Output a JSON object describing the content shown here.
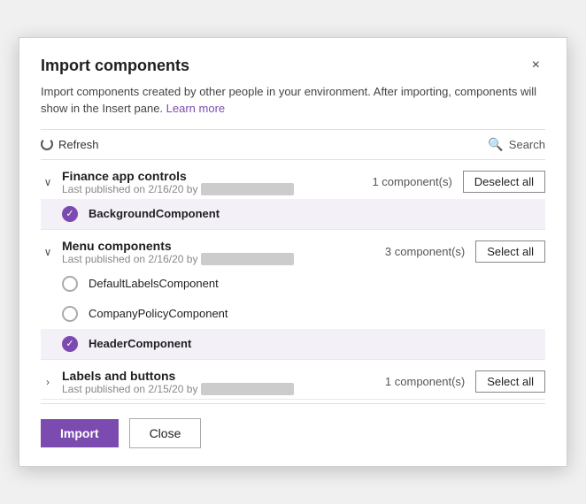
{
  "dialog": {
    "title": "Import components",
    "close_label": "×",
    "description": "Import components created by other people in your environment. After importing, components will show in the Insert pane.",
    "learn_more": "Learn more",
    "toolbar": {
      "refresh_label": "Refresh",
      "search_placeholder": "Search"
    },
    "groups": [
      {
        "id": "finance",
        "name": "Finance app controls",
        "meta": "Last published on 2/16/20 by",
        "author_blur": "████ ████████",
        "count": "1 component(s)",
        "action_label": "Deselect all",
        "action_type": "deselect",
        "expanded": true,
        "components": [
          {
            "id": "bg",
            "name": "BackgroundComponent",
            "selected": true
          }
        ]
      },
      {
        "id": "menu",
        "name": "Menu components",
        "meta": "Last published on 2/16/20 by",
        "author_blur": "████ ████████",
        "count": "3 component(s)",
        "action_label": "Select all",
        "action_type": "select",
        "expanded": true,
        "components": [
          {
            "id": "dlc",
            "name": "DefaultLabelsComponent",
            "selected": false
          },
          {
            "id": "cpc",
            "name": "CompanyPolicyComponent",
            "selected": false
          },
          {
            "id": "hc",
            "name": "HeaderComponent",
            "selected": true
          }
        ]
      },
      {
        "id": "labels",
        "name": "Labels and buttons",
        "meta": "Last published on 2/15/20 by",
        "author_blur": "████ ████████",
        "count": "1 component(s)",
        "action_label": "Select all",
        "action_type": "select",
        "expanded": false,
        "components": []
      }
    ],
    "footer": {
      "import_label": "Import",
      "close_label": "Close"
    }
  }
}
